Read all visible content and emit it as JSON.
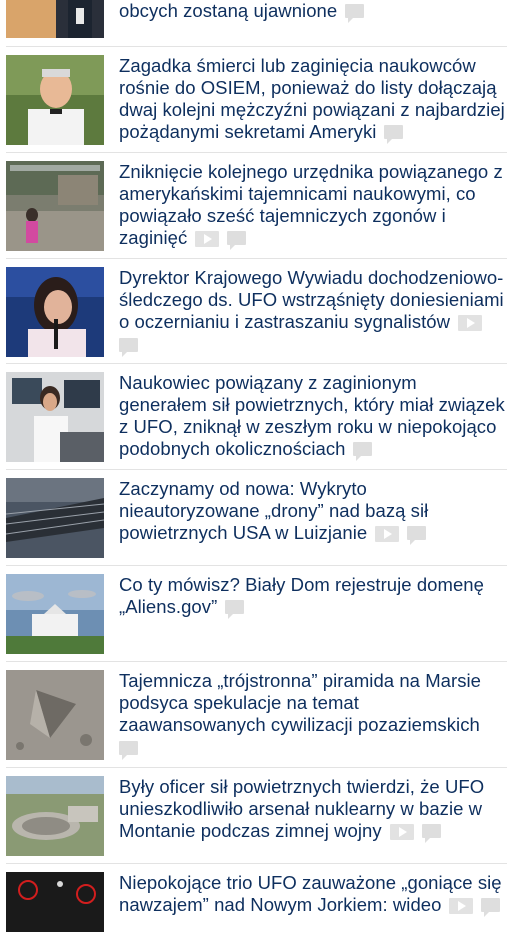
{
  "articles": [
    {
      "title": "panowanie nad sobą, jeśli akta dotyczące obcych zostaną ujawnione",
      "has_video": false
    },
    {
      "title": "Zagadka śmierci lub zaginięcia naukowców rośnie do OSIEM, ponieważ do listy dołączają dwaj kolejni mężczyźni powiązani z najbardziej pożądanymi sekretami Ameryki",
      "has_video": false
    },
    {
      "title": "Zniknięcie kolejnego urzędnika powiązanego z amerykańskimi tajemnicami naukowymi, co powiązało sześć tajemniczych zgonów i zaginięć",
      "has_video": true
    },
    {
      "title": "Dyrektor Krajowego Wywiadu dochodzeniowo-śledczego ds. UFO wstrząśnięty doniesieniami o oczernianiu i zastraszaniu sygnalistów",
      "has_video": true
    },
    {
      "title": "Naukowiec powiązany z zaginionym generałem sił powietrznych, który miał związek z UFO, zniknął w zeszłym roku w niepokojąco podobnych okolicznościach",
      "has_video": false
    },
    {
      "title": "Zaczynamy od nowa: Wykryto nieautoryzowane „drony” nad bazą sił powietrznych USA w Luizjanie",
      "has_video": true
    },
    {
      "title": "Co ty mówisz? Biały Dom rejestruje domenę „Aliens.gov”",
      "has_video": false
    },
    {
      "title": "Tajemnicza „trójstronna” piramida na Marsie podsyca spekulacje na temat zaawansowanych cywilizacji pozaziemskich",
      "has_video": false
    },
    {
      "title": "Były oficer sił powietrznych twierdzi, że UFO unieszkodliwiło arsenał nuklearny w bazie w Montanie podczas zimnej wojny",
      "has_video": true
    },
    {
      "title": "Niepokojące trio UFO zauważone „goniące się nawzajem” nad Nowym Jorkiem: wideo",
      "has_video": true
    }
  ],
  "icons": {
    "video": "video-play-icon",
    "comment": "comment-bubble-icon"
  },
  "colors": {
    "headline": "#0e2f5e",
    "icon_gray": "#dedede",
    "separator": "#e3e3e3"
  }
}
